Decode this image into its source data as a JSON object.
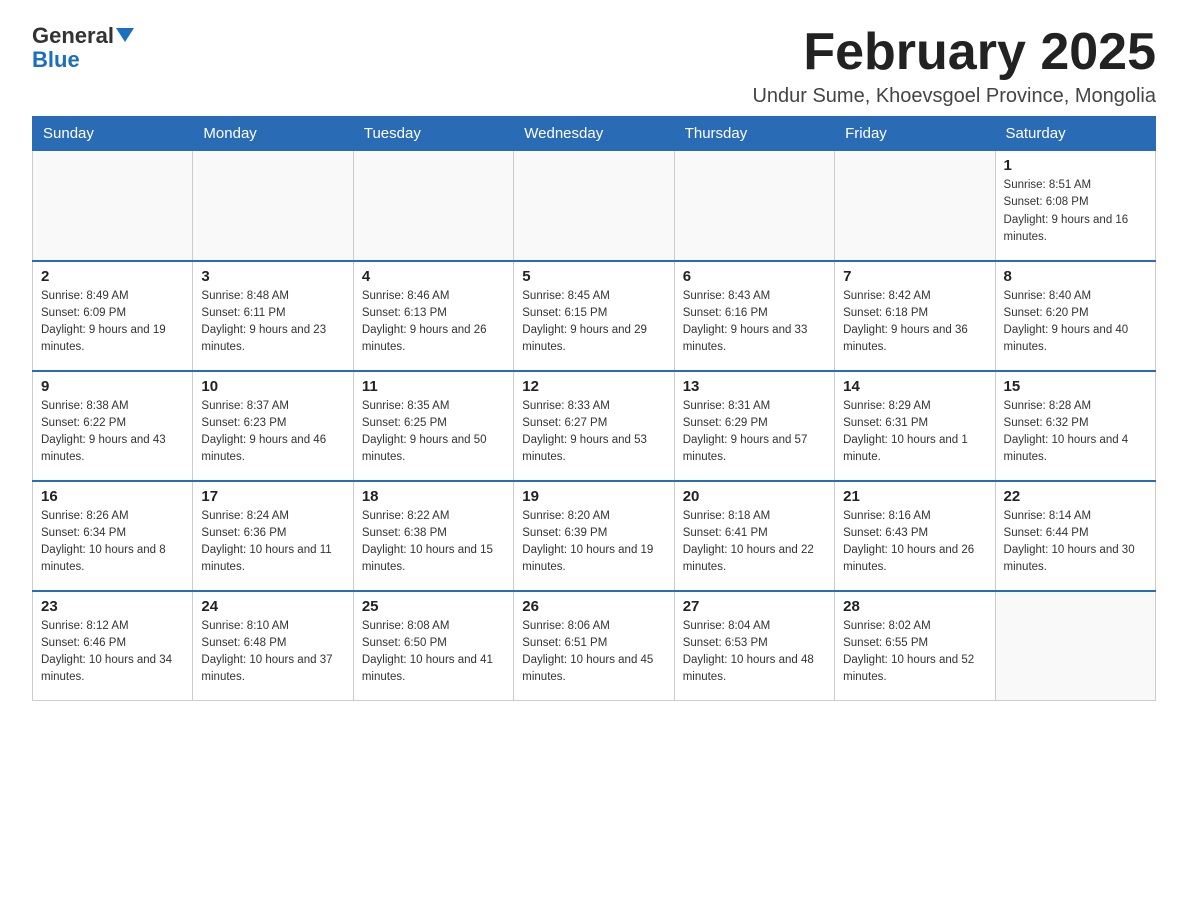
{
  "header": {
    "logo_line1": "General",
    "logo_line2": "Blue",
    "month_title": "February 2025",
    "location": "Undur Sume, Khoevsgoel Province, Mongolia"
  },
  "weekdays": [
    "Sunday",
    "Monday",
    "Tuesday",
    "Wednesday",
    "Thursday",
    "Friday",
    "Saturday"
  ],
  "weeks": [
    [
      {
        "day": "",
        "info": ""
      },
      {
        "day": "",
        "info": ""
      },
      {
        "day": "",
        "info": ""
      },
      {
        "day": "",
        "info": ""
      },
      {
        "day": "",
        "info": ""
      },
      {
        "day": "",
        "info": ""
      },
      {
        "day": "1",
        "info": "Sunrise: 8:51 AM\nSunset: 6:08 PM\nDaylight: 9 hours and 16 minutes."
      }
    ],
    [
      {
        "day": "2",
        "info": "Sunrise: 8:49 AM\nSunset: 6:09 PM\nDaylight: 9 hours and 19 minutes."
      },
      {
        "day": "3",
        "info": "Sunrise: 8:48 AM\nSunset: 6:11 PM\nDaylight: 9 hours and 23 minutes."
      },
      {
        "day": "4",
        "info": "Sunrise: 8:46 AM\nSunset: 6:13 PM\nDaylight: 9 hours and 26 minutes."
      },
      {
        "day": "5",
        "info": "Sunrise: 8:45 AM\nSunset: 6:15 PM\nDaylight: 9 hours and 29 minutes."
      },
      {
        "day": "6",
        "info": "Sunrise: 8:43 AM\nSunset: 6:16 PM\nDaylight: 9 hours and 33 minutes."
      },
      {
        "day": "7",
        "info": "Sunrise: 8:42 AM\nSunset: 6:18 PM\nDaylight: 9 hours and 36 minutes."
      },
      {
        "day": "8",
        "info": "Sunrise: 8:40 AM\nSunset: 6:20 PM\nDaylight: 9 hours and 40 minutes."
      }
    ],
    [
      {
        "day": "9",
        "info": "Sunrise: 8:38 AM\nSunset: 6:22 PM\nDaylight: 9 hours and 43 minutes."
      },
      {
        "day": "10",
        "info": "Sunrise: 8:37 AM\nSunset: 6:23 PM\nDaylight: 9 hours and 46 minutes."
      },
      {
        "day": "11",
        "info": "Sunrise: 8:35 AM\nSunset: 6:25 PM\nDaylight: 9 hours and 50 minutes."
      },
      {
        "day": "12",
        "info": "Sunrise: 8:33 AM\nSunset: 6:27 PM\nDaylight: 9 hours and 53 minutes."
      },
      {
        "day": "13",
        "info": "Sunrise: 8:31 AM\nSunset: 6:29 PM\nDaylight: 9 hours and 57 minutes."
      },
      {
        "day": "14",
        "info": "Sunrise: 8:29 AM\nSunset: 6:31 PM\nDaylight: 10 hours and 1 minute."
      },
      {
        "day": "15",
        "info": "Sunrise: 8:28 AM\nSunset: 6:32 PM\nDaylight: 10 hours and 4 minutes."
      }
    ],
    [
      {
        "day": "16",
        "info": "Sunrise: 8:26 AM\nSunset: 6:34 PM\nDaylight: 10 hours and 8 minutes."
      },
      {
        "day": "17",
        "info": "Sunrise: 8:24 AM\nSunset: 6:36 PM\nDaylight: 10 hours and 11 minutes."
      },
      {
        "day": "18",
        "info": "Sunrise: 8:22 AM\nSunset: 6:38 PM\nDaylight: 10 hours and 15 minutes."
      },
      {
        "day": "19",
        "info": "Sunrise: 8:20 AM\nSunset: 6:39 PM\nDaylight: 10 hours and 19 minutes."
      },
      {
        "day": "20",
        "info": "Sunrise: 8:18 AM\nSunset: 6:41 PM\nDaylight: 10 hours and 22 minutes."
      },
      {
        "day": "21",
        "info": "Sunrise: 8:16 AM\nSunset: 6:43 PM\nDaylight: 10 hours and 26 minutes."
      },
      {
        "day": "22",
        "info": "Sunrise: 8:14 AM\nSunset: 6:44 PM\nDaylight: 10 hours and 30 minutes."
      }
    ],
    [
      {
        "day": "23",
        "info": "Sunrise: 8:12 AM\nSunset: 6:46 PM\nDaylight: 10 hours and 34 minutes."
      },
      {
        "day": "24",
        "info": "Sunrise: 8:10 AM\nSunset: 6:48 PM\nDaylight: 10 hours and 37 minutes."
      },
      {
        "day": "25",
        "info": "Sunrise: 8:08 AM\nSunset: 6:50 PM\nDaylight: 10 hours and 41 minutes."
      },
      {
        "day": "26",
        "info": "Sunrise: 8:06 AM\nSunset: 6:51 PM\nDaylight: 10 hours and 45 minutes."
      },
      {
        "day": "27",
        "info": "Sunrise: 8:04 AM\nSunset: 6:53 PM\nDaylight: 10 hours and 48 minutes."
      },
      {
        "day": "28",
        "info": "Sunrise: 8:02 AM\nSunset: 6:55 PM\nDaylight: 10 hours and 52 minutes."
      },
      {
        "day": "",
        "info": ""
      }
    ]
  ]
}
